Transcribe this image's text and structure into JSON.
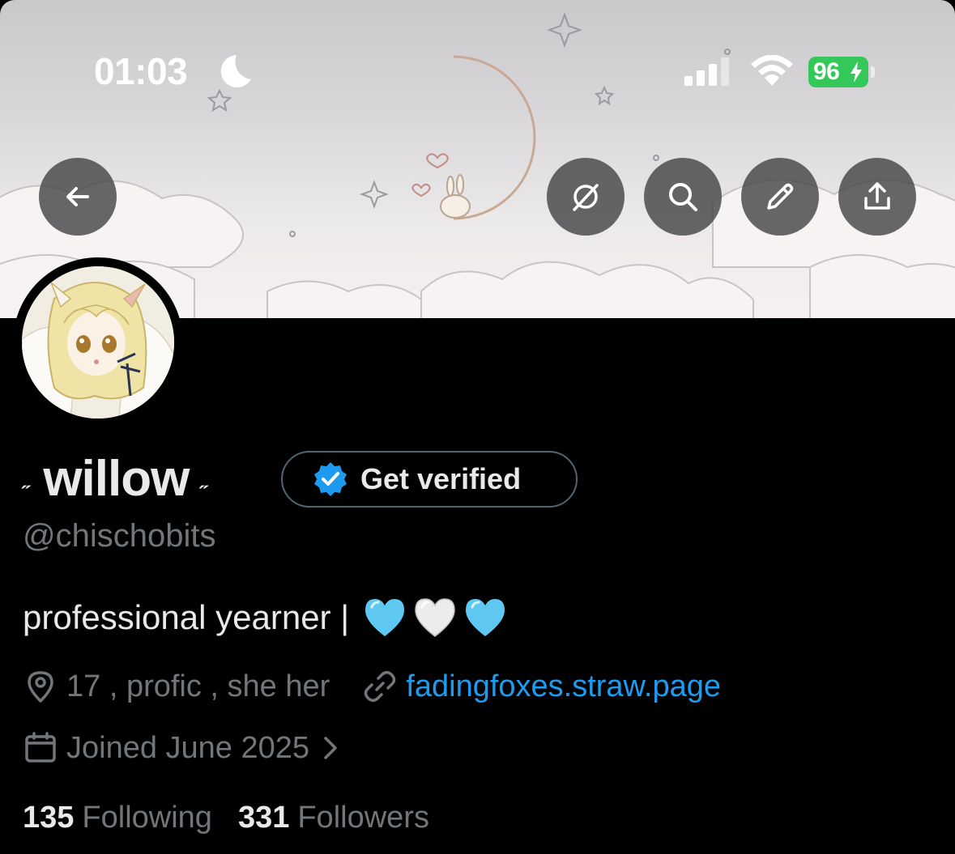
{
  "status_bar": {
    "time": "01:03",
    "battery_level": "96",
    "battery_charging": true,
    "focus_mode_icon": "moon-icon"
  },
  "header_buttons": {
    "back": "back-arrow-icon",
    "grok": "grok-icon",
    "search": "search-icon",
    "edit": "pencil-icon",
    "share": "share-icon"
  },
  "profile": {
    "name_decoration_left": "˶",
    "display_name": "willow",
    "name_decoration_right": "˶",
    "verify_label": "Get verified",
    "handle": "@chischobits",
    "bio": "professional yearner |",
    "bio_emojis": [
      "light-blue-heart",
      "white-heart",
      "light-blue-heart"
    ],
    "location": "17 , profic , she her",
    "website": "fadingfoxes.straw.page",
    "joined": "Joined June 2025",
    "following_count": "135",
    "following_label": "Following",
    "followers_count": "331",
    "followers_label": "Followers"
  },
  "colors": {
    "background": "#000000",
    "text_primary": "#e7e9ea",
    "text_secondary": "#71767b",
    "link": "#1d9bf0",
    "verified_badge": "#1d9bf0",
    "battery": "#34c759"
  }
}
